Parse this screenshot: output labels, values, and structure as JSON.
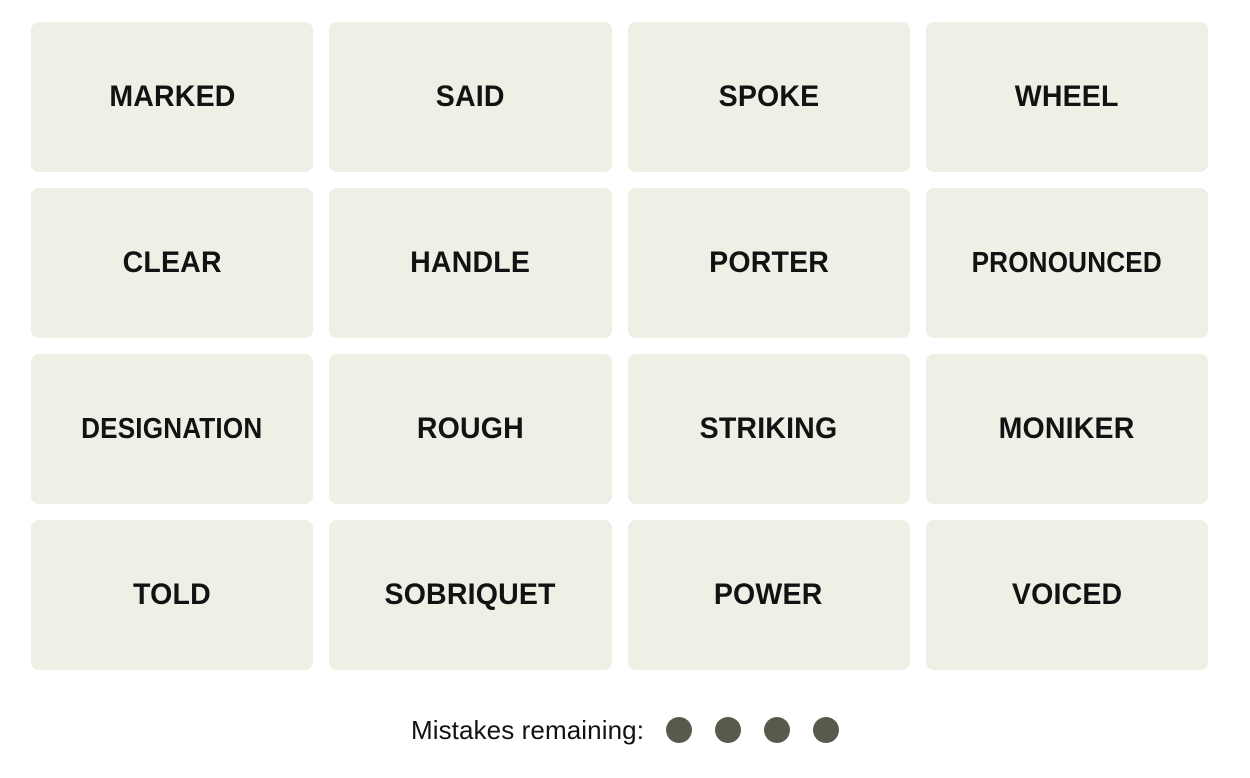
{
  "game": {
    "name": "Connections",
    "tile_bg_color": "#EFEFE6",
    "tile_text_color": "#121212",
    "page_bg_color": "#FFFFFF",
    "dot_color": "#5A594E"
  },
  "grid": {
    "columns": 4,
    "rows": 4,
    "tiles": [
      {
        "label": "MARKED",
        "row": 1,
        "col": 1,
        "selected": false
      },
      {
        "label": "SAID",
        "row": 1,
        "col": 2,
        "selected": false
      },
      {
        "label": "SPOKE",
        "row": 1,
        "col": 3,
        "selected": false
      },
      {
        "label": "WHEEL",
        "row": 1,
        "col": 4,
        "selected": false
      },
      {
        "label": "CLEAR",
        "row": 2,
        "col": 1,
        "selected": false
      },
      {
        "label": "HANDLE",
        "row": 2,
        "col": 2,
        "selected": false
      },
      {
        "label": "PORTER",
        "row": 2,
        "col": 3,
        "selected": false
      },
      {
        "label": "PRONOUNCED",
        "row": 2,
        "col": 4,
        "selected": false
      },
      {
        "label": "DESIGNATION",
        "row": 3,
        "col": 1,
        "selected": false
      },
      {
        "label": "ROUGH",
        "row": 3,
        "col": 2,
        "selected": false
      },
      {
        "label": "STRIKING",
        "row": 3,
        "col": 3,
        "selected": false
      },
      {
        "label": "MONIKER",
        "row": 3,
        "col": 4,
        "selected": false
      },
      {
        "label": "TOLD",
        "row": 4,
        "col": 1,
        "selected": false
      },
      {
        "label": "SOBRIQUET",
        "row": 4,
        "col": 2,
        "selected": false
      },
      {
        "label": "POWER",
        "row": 4,
        "col": 3,
        "selected": false
      },
      {
        "label": "VOICED",
        "row": 4,
        "col": 4,
        "selected": false
      }
    ]
  },
  "footer": {
    "mistakes_label": "Mistakes remaining:",
    "mistakes_remaining": 4,
    "dots": [
      1,
      2,
      3,
      4
    ]
  }
}
